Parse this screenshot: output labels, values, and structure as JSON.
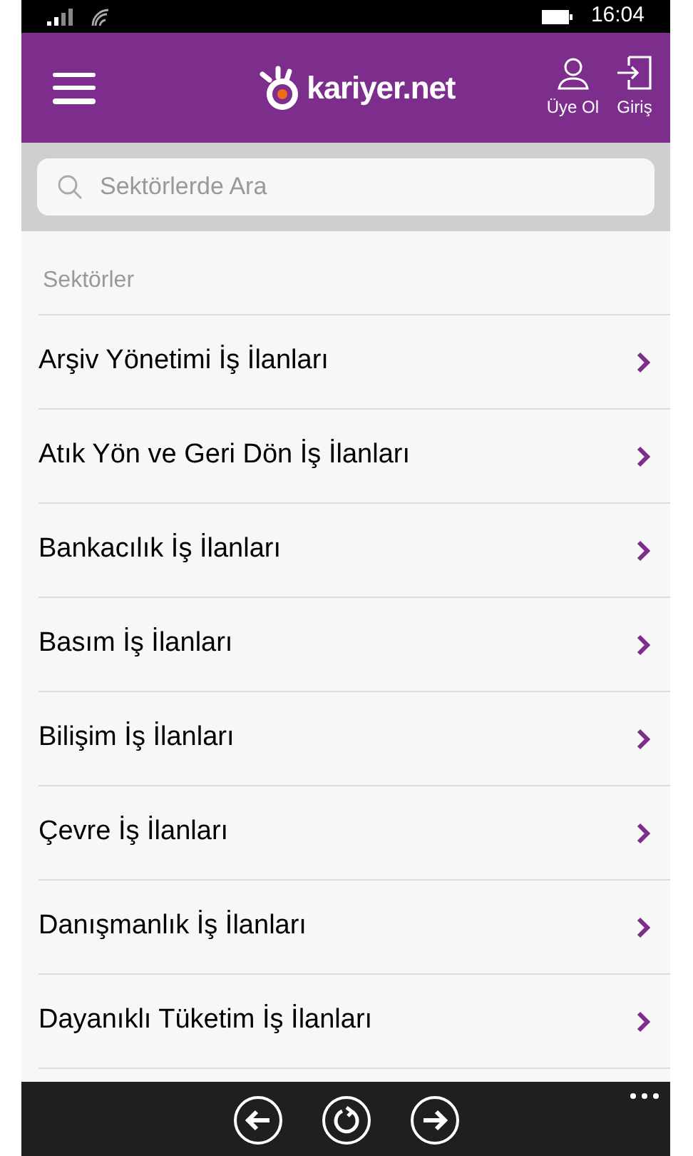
{
  "status_bar": {
    "time": "16:04"
  },
  "header": {
    "logo_text": "kariyer.net",
    "actions": [
      {
        "kind": "user",
        "label": "Üye Ol"
      },
      {
        "kind": "login",
        "label": "Giriş"
      }
    ]
  },
  "search": {
    "placeholder": "Sektörlerde Ara"
  },
  "section_title": "Sektörler",
  "items": [
    {
      "label": "Arşiv Yönetimi İş İlanları"
    },
    {
      "label": "Atık Yön ve Geri Dön İş İlanları"
    },
    {
      "label": "Bankacılık İş İlanları"
    },
    {
      "label": "Basım İş İlanları"
    },
    {
      "label": "Bilişim İş İlanları"
    },
    {
      "label": "Çevre İş İlanları"
    },
    {
      "label": "Danışmanlık İş İlanları"
    },
    {
      "label": "Dayanıklı Tüketim İş İlanları"
    }
  ],
  "app_bar": {
    "buttons": [
      {
        "kind": "back"
      },
      {
        "kind": "refresh"
      },
      {
        "kind": "forward"
      }
    ]
  }
}
